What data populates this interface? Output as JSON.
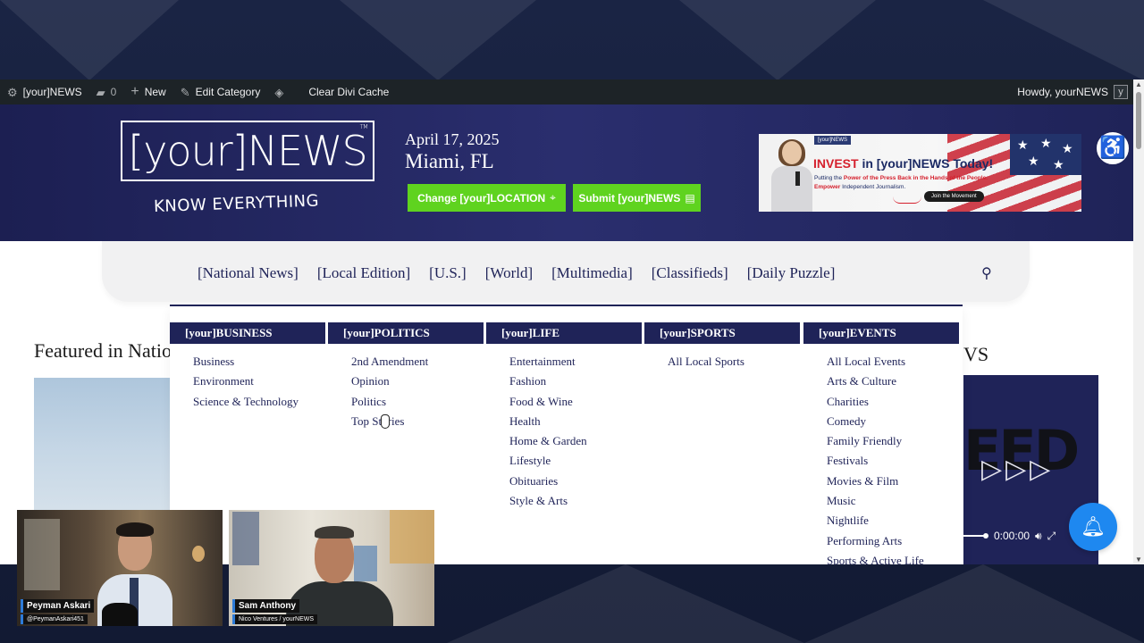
{
  "admin_bar": {
    "site_name": "[your]NEWS",
    "comments_count": "0",
    "new_label": "New",
    "edit_category_label": "Edit Category",
    "clear_cache_label": "Clear Divi Cache",
    "howdy_text": "Howdy, yourNEWS",
    "avatar_letter": "y"
  },
  "header": {
    "logo_text": "[your]NEWS",
    "logo_tm": "TM",
    "logo_tagline": "KNOW EVERYTHING",
    "date": "April 17, 2025",
    "location": "Miami, FL",
    "change_location_button": "Change [your]LOCATION",
    "submit_news_button": "Submit [your]NEWS"
  },
  "ad_banner": {
    "badge": "[your]NEWS",
    "title_invest": "INVEST",
    "title_rest": " in [your]NEWS Today!",
    "line1_pre": "Putting the ",
    "line1_red": "Power of the Press Back in the Hands of the People.",
    "line2_red": "Empower",
    "line2_rest": " Independent Journalism.",
    "cta": "Join the Movement"
  },
  "nav": {
    "items": [
      "[National News]",
      "[Local Edition]",
      "[U.S.]",
      "[World]",
      "[Multimedia]",
      "[Classifieds]",
      "[Daily Puzzle]"
    ]
  },
  "main": {
    "left_heading": "Featured in National News",
    "right_heading": "VS"
  },
  "mega_menu": {
    "columns": [
      {
        "heading": "[your]BUSINESS",
        "items": [
          "Business",
          "Environment",
          "Science & Technology"
        ]
      },
      {
        "heading": "[your]POLITICS",
        "items": [
          "2nd Amendment",
          "Opinion",
          "Politics",
          "Top Stories"
        ]
      },
      {
        "heading": "[your]LIFE",
        "items": [
          "Entertainment",
          "Fashion",
          "Food & Wine",
          "Health",
          "Home & Garden",
          "Lifestyle",
          "Obituaries",
          "Style & Arts"
        ]
      },
      {
        "heading": "[your]SPORTS",
        "items": [
          "All Local Sports"
        ]
      },
      {
        "heading": "[your]EVENTS",
        "items": [
          "All Local Events",
          "Arts & Culture",
          "Charities",
          "Comedy",
          "Family Friendly",
          "Festivals",
          "Movies & Film",
          "Music",
          "Nightlife",
          "Performing Arts",
          "Sports & Active Life"
        ]
      }
    ]
  },
  "video": {
    "title_fragment": "EED",
    "time": "0:00:00"
  },
  "participants": [
    {
      "name": "Peyman Askari",
      "subtitle": "@PeymanAskari451"
    },
    {
      "name": "Sam Anthony",
      "subtitle": "Nico Ventures / yourNEWS"
    }
  ],
  "colors": {
    "brand_navy": "#1f2358",
    "accent_green": "#5fd31f",
    "bell_blue": "#1e88f0"
  },
  "icons": [
    "wordpress-icon",
    "comment-icon",
    "plus-icon",
    "pencil-icon",
    "divi-icon",
    "accessibility-icon",
    "search-icon",
    "location-pin-icon",
    "document-icon",
    "bell-icon",
    "volume-icon",
    "fullscreen-icon"
  ]
}
